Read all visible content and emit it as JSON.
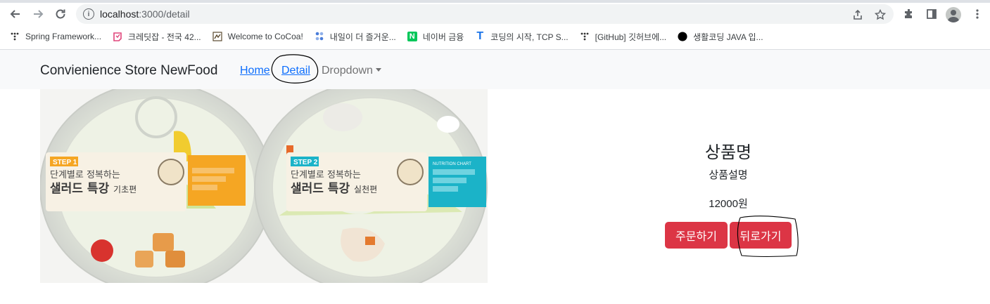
{
  "browser": {
    "url_host": "localhost",
    "url_path": ":3000/detail",
    "bookmarks": [
      {
        "label": "Spring Framework...",
        "icon": "spring-icon",
        "color": "#333333"
      },
      {
        "label": "크레딧잡 - 전국 42...",
        "icon": "kreditjob-icon",
        "color": "#e0457b"
      },
      {
        "label": "Welcome to CoCoa!",
        "icon": "cocoa-icon",
        "color": "#5b4a2f"
      },
      {
        "label": "내일이 더 즐거운...",
        "icon": "dots-icon",
        "color": "#4a7dd9"
      },
      {
        "label": "네이버 금융",
        "icon": "naver-icon",
        "color": "#03c75a"
      },
      {
        "label": "코딩의 시작, TCP S...",
        "icon": "tcp-icon",
        "color": "#1a73e8"
      },
      {
        "label": "[GitHub] 깃허브에...",
        "icon": "github-dots-icon",
        "color": "#333333"
      },
      {
        "label": "생활코딩 JAVA 입...",
        "icon": "opentutorials-icon",
        "color": "#000000"
      }
    ]
  },
  "navbar": {
    "brand": "Convienience Store NewFood",
    "home": "Home",
    "detail": "Detail",
    "dropdown": "Dropdown"
  },
  "product": {
    "image_alt_left_step": "STEP 1",
    "image_left_title_1": "단계별로 정복하는",
    "image_left_title_2": "샐러드 특강",
    "image_left_title_3": "기초편",
    "image_right_step": "STEP 2",
    "image_right_title_1": "단계별로 정복하는",
    "image_right_title_2": "샐러드 특강",
    "image_right_title_3": "실천편",
    "nutrition_label": "NUTRITION CHART",
    "title": "상품명",
    "description": "상품설명",
    "price": "12000원",
    "order_button": "주문하기",
    "back_button": "뒤로가기"
  },
  "colors": {
    "danger": "#dc3545",
    "link": "#0d6efd",
    "navbar_bg": "#f8f9fa",
    "step1": "#f5a623",
    "step2": "#1bb3c8"
  }
}
